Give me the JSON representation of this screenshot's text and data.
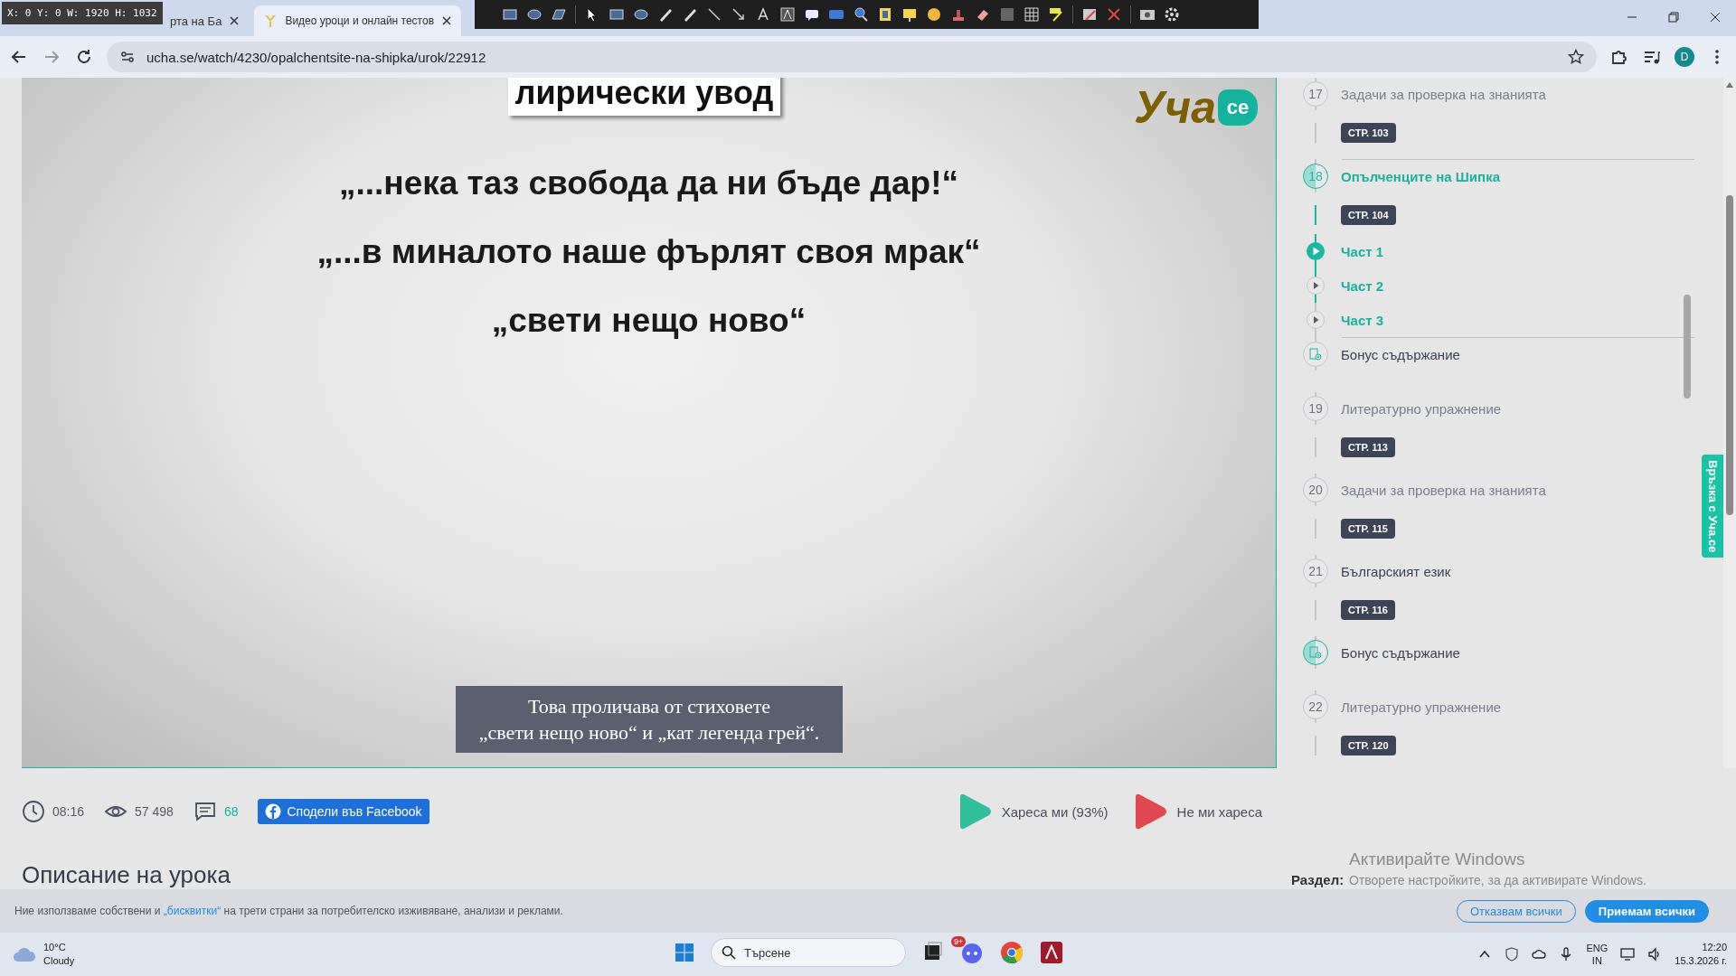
{
  "capture_overlay": {
    "readout": "X: 0 Y: 0 W: 1920 H: 1032"
  },
  "browser": {
    "tabs": [
      {
        "title": "рта на Ба",
        "selected": false
      },
      {
        "title": "Видео уроци и онлайн тестов",
        "selected": true
      }
    ],
    "url": "ucha.se/watch/4230/opalchentsite-na-shipka/urok/22912",
    "profile": "D"
  },
  "video": {
    "heading": "лирически увод",
    "lines": [
      "„...нека таз свобода да ни бъде дар!“",
      "„...в миналото наше фърлят своя мрак“",
      "„свети нещо ново“"
    ],
    "caption": [
      "Това проличава от стиховете",
      "„свети нещо ново“ и „кат легенда грей“."
    ],
    "logo": {
      "word": "Уча",
      "badge": "ce"
    }
  },
  "lessons": [
    {
      "kind": "lesson",
      "number": "17",
      "title": "Задачи за проверка на знанията",
      "page": "СТР. 103",
      "selected": false,
      "highlighted": false
    },
    {
      "kind": "lesson",
      "number": "18",
      "title": "Опълченците на Шипка",
      "page": "СТР. 104",
      "selected": true,
      "children": [
        {
          "label": "Част 1",
          "selected": true
        },
        {
          "label": "Част 2",
          "selected": false
        },
        {
          "label": "Част 3",
          "selected": false
        }
      ]
    },
    {
      "kind": "bonus",
      "title": "Бонус съдържание",
      "selected": false
    },
    {
      "kind": "lesson",
      "number": "19",
      "title": "Литературно упражнение",
      "page": "СТР. 113",
      "selected": false,
      "highlighted": false
    },
    {
      "kind": "lesson",
      "number": "20",
      "title": "Задачи за проверка на знанията",
      "page": "СТР. 115",
      "selected": false,
      "highlighted": false
    },
    {
      "kind": "lesson",
      "number": "21",
      "title": "Българският език",
      "page": "СТР. 116",
      "selected": false,
      "highlighted": true
    },
    {
      "kind": "bonus",
      "title": "Бонус съдържание",
      "selected": true
    },
    {
      "kind": "lesson",
      "number": "22",
      "title": "Литературно упражнение",
      "page": "СТР. 120",
      "selected": false,
      "highlighted": false
    }
  ],
  "contact_tab": "Връзка с Уча.се",
  "stats": {
    "duration": "08:16",
    "views": "57 498",
    "comments": "68",
    "share": "Сподели във Facebook",
    "like": "Хареса ми (93%)",
    "dislike": "Не ми хареса"
  },
  "description": {
    "heading": "Описание на урока",
    "section_label": "Раздел:"
  },
  "activation_notice": {
    "title": "Активирайте Windows",
    "text": "Отворете настройките, за да активирате Windows."
  },
  "cookie_bar": {
    "before": "Ние използваме собствени и ",
    "link": "„бисквитки“",
    "after": " на трети страни за потребителско изживяване, анализи и реклами.",
    "buttons": [
      {
        "label": "Отказвам всички",
        "kind": "outline"
      },
      {
        "label": "Приемам всички",
        "kind": "primary"
      }
    ]
  },
  "taskbar": {
    "weather": {
      "temp": "10°C",
      "condition": "Cloudy"
    },
    "search": {
      "placeholder": "Търсене"
    },
    "badge": "9+",
    "language": [
      "ENG",
      "IN"
    ],
    "time": "12:20",
    "date": "15.3.2026 г."
  }
}
